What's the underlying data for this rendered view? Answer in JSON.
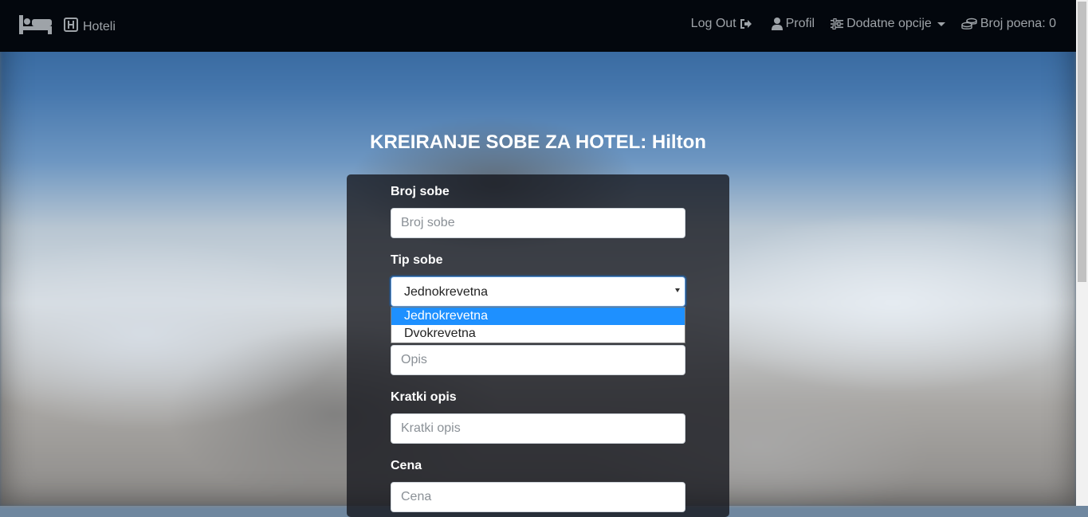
{
  "navbar": {
    "brand_icon": "bed-icon",
    "hotels_label": "Hoteli",
    "logout_label": "Log Out",
    "profile_label": "Profil",
    "options_label": "Dodatne opcije",
    "points_label": "Broj poena: 0"
  },
  "page": {
    "title": "KREIRANJE SOBE ZA HOTEL: Hilton"
  },
  "form": {
    "room_number_label": "Broj sobe",
    "room_number_placeholder": "Broj sobe",
    "room_type_label": "Tip sobe",
    "room_type_selected": "Jednokrevetna",
    "room_type_options": [
      "Jednokrevetna",
      "Dvokrevetna"
    ],
    "description_placeholder": "Opis",
    "short_desc_label": "Kratki opis",
    "short_desc_placeholder": "Kratki opis",
    "price_label": "Cena",
    "price_placeholder": "Cena"
  },
  "colors": {
    "navbar_bg": "#03070d",
    "nav_text": "#9ea3a8",
    "highlight": "#1e90ff"
  }
}
